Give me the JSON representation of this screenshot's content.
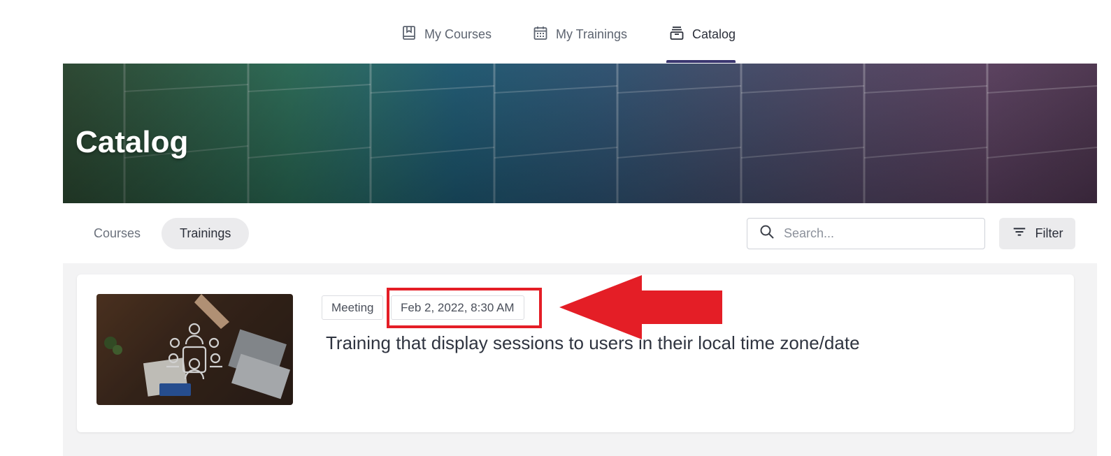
{
  "topnav": {
    "items": [
      {
        "label": "My Courses",
        "icon": "bookmark-book-icon"
      },
      {
        "label": "My Trainings",
        "icon": "calendar-icon"
      },
      {
        "label": "Catalog",
        "icon": "catalog-tray-icon",
        "active": true
      }
    ],
    "accent_color": "#3b3770"
  },
  "hero": {
    "title": "Catalog"
  },
  "tabs": [
    {
      "label": "Courses"
    },
    {
      "label": "Trainings",
      "active": true
    }
  ],
  "search": {
    "placeholder": "Search...",
    "value": ""
  },
  "filter": {
    "label": "Filter"
  },
  "card": {
    "type_badge": "Meeting",
    "date_badge": "Feb 2, 2022, 8:30 AM",
    "title": "Training that display sessions to users in their local time zone/date"
  },
  "annotation": {
    "color": "#e41e26"
  }
}
